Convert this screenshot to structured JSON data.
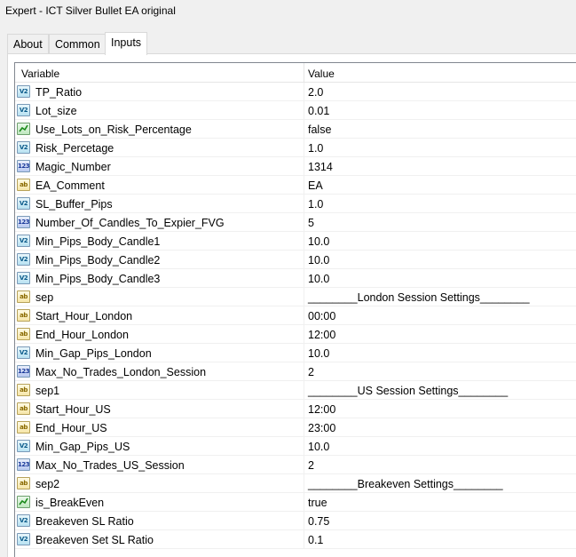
{
  "window": {
    "title": "Expert - ICT Silver Bullet EA original"
  },
  "tabs": [
    {
      "label": "About",
      "active": false
    },
    {
      "label": "Common",
      "active": false
    },
    {
      "label": "Inputs",
      "active": true
    }
  ],
  "table": {
    "headers": {
      "variable": "Variable",
      "value": "Value"
    },
    "rows": [
      {
        "type": "double",
        "icon": "V2",
        "name": "TP_Ratio",
        "value": "2.0"
      },
      {
        "type": "double",
        "icon": "V2",
        "name": "Lot_size",
        "value": "0.01"
      },
      {
        "type": "bool",
        "icon": "bool-icon",
        "name": "Use_Lots_on_Risk_Percentage",
        "value": "false"
      },
      {
        "type": "double",
        "icon": "V2",
        "name": "Risk_Percetage",
        "value": "1.0"
      },
      {
        "type": "int",
        "icon": "123",
        "name": "Magic_Number",
        "value": "1314"
      },
      {
        "type": "string",
        "icon": "ab",
        "name": "EA_Comment",
        "value": "EA"
      },
      {
        "type": "double",
        "icon": "V2",
        "name": "SL_Buffer_Pips",
        "value": "1.0"
      },
      {
        "type": "int",
        "icon": "123",
        "name": "Number_Of_Candles_To_Expier_FVG",
        "value": "5"
      },
      {
        "type": "double",
        "icon": "V2",
        "name": "Min_Pips_Body_Candle1",
        "value": "10.0"
      },
      {
        "type": "double",
        "icon": "V2",
        "name": "Min_Pips_Body_Candle2",
        "value": "10.0"
      },
      {
        "type": "double",
        "icon": "V2",
        "name": "Min_Pips_Body_Candle3",
        "value": "10.0"
      },
      {
        "type": "string",
        "icon": "ab",
        "name": "sep",
        "value": "________London Session Settings________"
      },
      {
        "type": "string",
        "icon": "ab",
        "name": "Start_Hour_London",
        "value": "00:00"
      },
      {
        "type": "string",
        "icon": "ab",
        "name": "End_Hour_London",
        "value": "12:00"
      },
      {
        "type": "double",
        "icon": "V2",
        "name": "Min_Gap_Pips_London",
        "value": "10.0"
      },
      {
        "type": "int",
        "icon": "123",
        "name": "Max_No_Trades_London_Session",
        "value": "2"
      },
      {
        "type": "string",
        "icon": "ab",
        "name": "sep1",
        "value": "________US Session Settings________"
      },
      {
        "type": "string",
        "icon": "ab",
        "name": "Start_Hour_US",
        "value": "12:00"
      },
      {
        "type": "string",
        "icon": "ab",
        "name": "End_Hour_US",
        "value": "23:00"
      },
      {
        "type": "double",
        "icon": "V2",
        "name": "Min_Gap_Pips_US",
        "value": "10.0"
      },
      {
        "type": "int",
        "icon": "123",
        "name": "Max_No_Trades_US_Session",
        "value": "2"
      },
      {
        "type": "string",
        "icon": "ab",
        "name": "sep2",
        "value": "________Breakeven Settings________"
      },
      {
        "type": "bool",
        "icon": "bool-icon",
        "name": "is_BreakEven",
        "value": "true"
      },
      {
        "type": "double",
        "icon": "V2",
        "name": "Breakeven SL Ratio",
        "value": "0.75"
      },
      {
        "type": "double",
        "icon": "V2",
        "name": "Breakeven Set SL Ratio",
        "value": "0.1"
      }
    ]
  }
}
